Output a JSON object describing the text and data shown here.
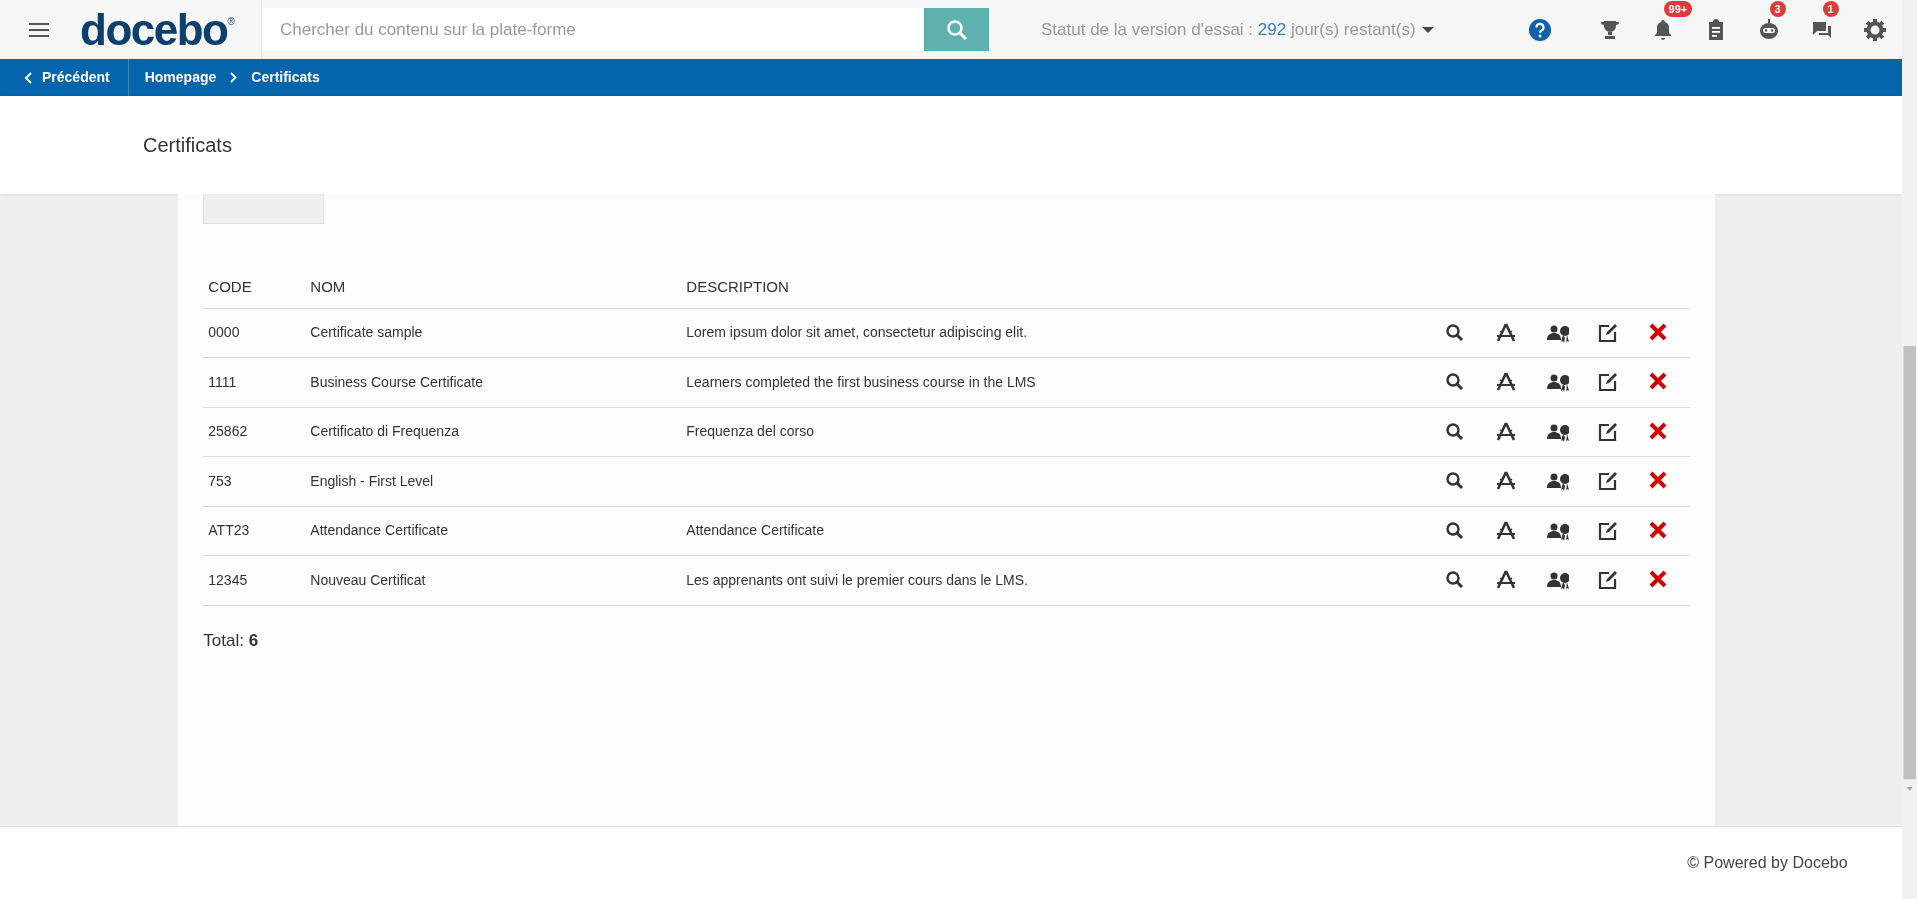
{
  "header": {
    "logo": {
      "name": "docebo",
      "mark": "®"
    },
    "search": {
      "placeholder": "Chercher du contenu sur la plate-forme"
    },
    "trial_status": {
      "label": "Statut de la version d'essai :",
      "days": "292",
      "suffix": "jour(s) restant(s)"
    },
    "icons": [
      {
        "kind": "help"
      },
      {
        "kind": "trophy"
      },
      {
        "kind": "bell",
        "badge": "99+"
      },
      {
        "kind": "clipboard"
      },
      {
        "kind": "robot",
        "badge": "3"
      },
      {
        "kind": "chat",
        "badge": "1"
      },
      {
        "kind": "gear"
      }
    ]
  },
  "breadcrumb": {
    "back": "Précédent",
    "items": [
      {
        "label": "Homepage"
      },
      {
        "label": "Certificats"
      }
    ]
  },
  "page_title": "Certificats",
  "table": {
    "columns": [
      "CODE",
      "NOM",
      "DESCRIPTION"
    ],
    "row_actions": [
      {
        "kind": "view"
      },
      {
        "kind": "template"
      },
      {
        "kind": "assign"
      },
      {
        "kind": "edit"
      },
      {
        "kind": "delete"
      }
    ],
    "rows": [
      {
        "code": "0000",
        "name": "Certificate sample",
        "description": "Lorem ipsum dolor sit amet, consectetur adipiscing elit."
      },
      {
        "code": "1111",
        "name": "Business Course Certificate",
        "description": "Learners completed the first business course in the LMS"
      },
      {
        "code": "25862",
        "name": "Certificato di Frequenza",
        "description": "Frequenza del corso"
      },
      {
        "code": "753",
        "name": "English - First Level"
      },
      {
        "code": "ATT23",
        "name": "Attendance Certificate",
        "description": "Attendance Certificate"
      },
      {
        "code": "12345",
        "name": "Nouveau Certificat",
        "description": "Les apprenants ont suivi le premier cours dans le LMS."
      }
    ]
  },
  "total": {
    "label": "Total:",
    "value": "6"
  },
  "footer": "© Powered by Docebo"
}
